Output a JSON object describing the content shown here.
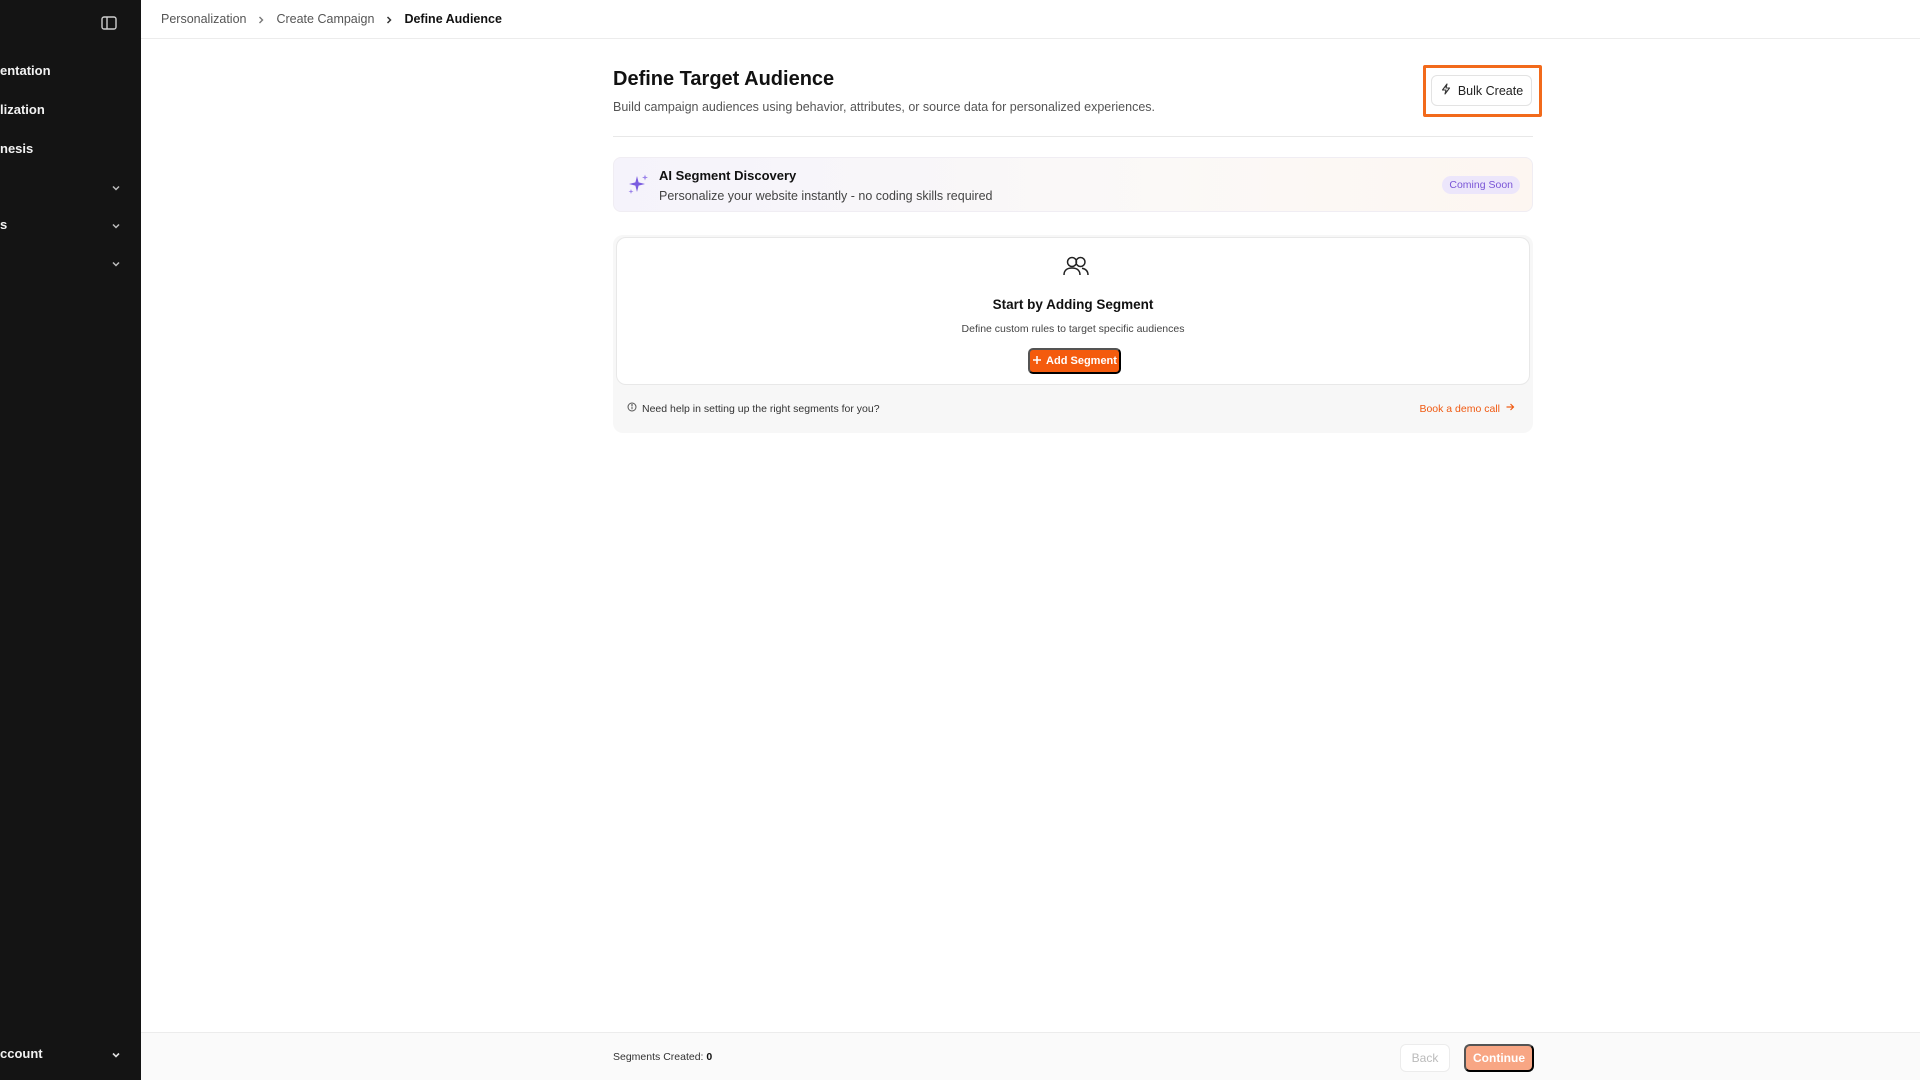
{
  "sidebar": {
    "items": [
      {
        "label": "entation",
        "has_chevron": false
      },
      {
        "label": "lization",
        "has_chevron": false
      },
      {
        "label": "nesis",
        "has_chevron": false
      },
      {
        "label": "",
        "has_chevron": true
      },
      {
        "label": "s",
        "has_chevron": true
      },
      {
        "label": "",
        "has_chevron": true
      }
    ],
    "account_label": "ccount"
  },
  "breadcrumb": {
    "items": [
      "Personalization",
      "Create Campaign",
      "Define Audience"
    ]
  },
  "header": {
    "title": "Define Target Audience",
    "subtitle": "Build campaign audiences using behavior, attributes, or source data for personalized experiences.",
    "bulk_create_label": "Bulk Create"
  },
  "ai_segment": {
    "title": "AI Segment Discovery",
    "subtitle": "Personalize your website instantly - no coding skills required",
    "badge": "Coming Soon"
  },
  "segments": {
    "empty_title": "Start by Adding Segment",
    "empty_subtitle": "Define custom rules to target specific audiences",
    "add_label": "Add Segment",
    "help_text": "Need help in setting up the right segments for you?",
    "demo_link": "Book a demo call"
  },
  "footer": {
    "segments_created_label": "Segments Created:",
    "segments_created_count": "0",
    "back_label": "Back",
    "continue_label": "Continue"
  },
  "colors": {
    "accent": "#f45b0d",
    "highlight": "#f26a1b",
    "sidebar_bg": "#141414",
    "badge_text": "#7a55d6"
  }
}
